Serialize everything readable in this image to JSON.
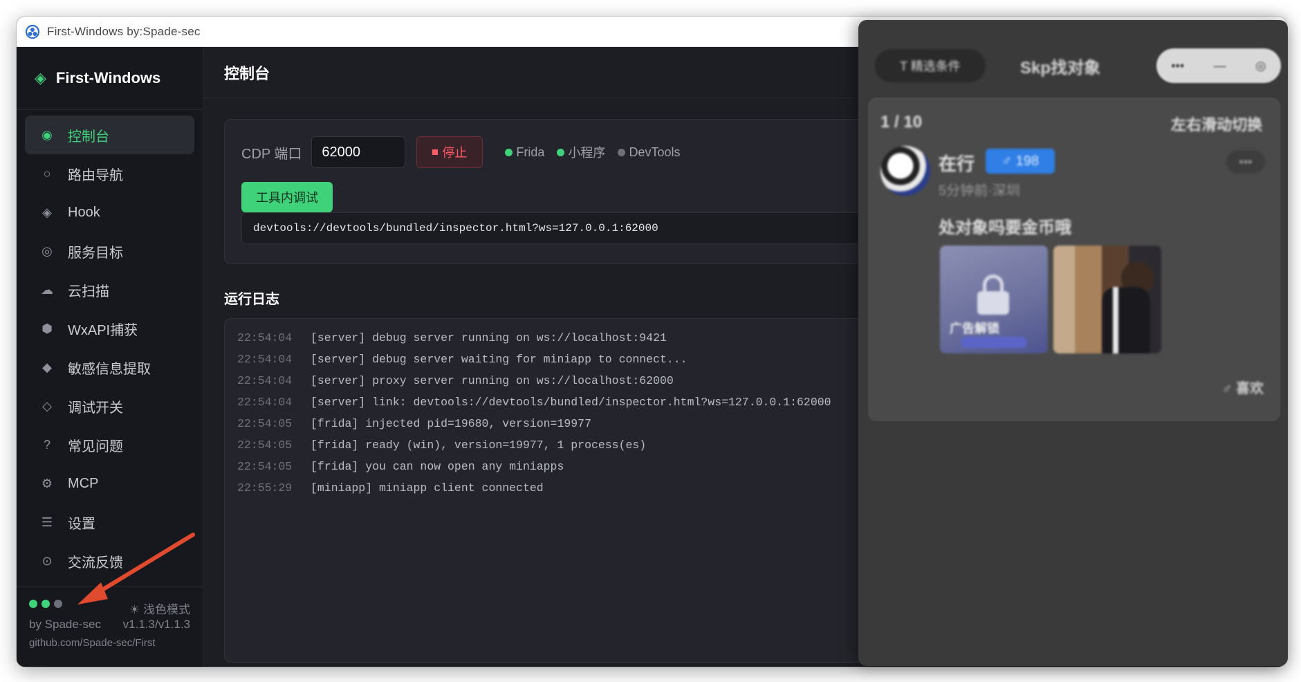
{
  "window": {
    "title": "First-Windows  by:Spade-sec"
  },
  "sidebar": {
    "brand": "First-Windows",
    "items": [
      {
        "label": "控制台",
        "icon": "target-icon"
      },
      {
        "label": "路由导航",
        "icon": "route-icon"
      },
      {
        "label": "Hook",
        "icon": "hook-icon"
      },
      {
        "label": "服务目标",
        "icon": "service-icon"
      },
      {
        "label": "云扫描",
        "icon": "cloud-icon"
      },
      {
        "label": "WxAPI捕获",
        "icon": "hexagon-icon"
      },
      {
        "label": "敏感信息提取",
        "icon": "diamond-icon"
      },
      {
        "label": "调试开关",
        "icon": "toggle-icon"
      },
      {
        "label": "常见问题",
        "icon": "question-icon"
      },
      {
        "label": "MCP",
        "icon": "gear-icon"
      },
      {
        "label": "设置",
        "icon": "menu-icon"
      },
      {
        "label": "交流反馈",
        "icon": "feedback-icon"
      }
    ],
    "footer": {
      "theme_toggle": "浅色模式",
      "author": "by Spade-sec",
      "version": "v1.1.3/v1.1.3",
      "repo": "github.com/Spade-sec/First"
    }
  },
  "main": {
    "page_title": "控制台",
    "cdp": {
      "label": "CDP 端口",
      "port_value": "62000",
      "stop_label": "停止",
      "statuses": [
        {
          "label": "Frida",
          "color": "#3fd27a"
        },
        {
          "label": "小程序",
          "color": "#3fd27a"
        },
        {
          "label": "DevTools",
          "color": "#6e717b"
        }
      ],
      "debug_button": "工具内调试",
      "devtools_url": "devtools://devtools/bundled/inspector.html?ws=127.0.0.1:62000"
    },
    "log_title": "运行日志",
    "logs": [
      {
        "time": "22:54:04",
        "msg": "[server] debug server running on ws://localhost:9421"
      },
      {
        "time": "22:54:04",
        "msg": "[server] debug server waiting for miniapp to connect..."
      },
      {
        "time": "22:54:04",
        "msg": "[server] proxy server running on ws://localhost:62000"
      },
      {
        "time": "22:54:04",
        "msg": "[server] link: devtools://devtools/bundled/inspector.html?ws=127.0.0.1:62000"
      },
      {
        "time": "22:54:05",
        "msg": "[frida] injected pid=19680, version=19977"
      },
      {
        "time": "22:54:05",
        "msg": "[frida] ready (win), version=19977, 1 process(es)"
      },
      {
        "time": "22:54:05",
        "msg": "[frida] you can now open any miniapps"
      },
      {
        "time": "22:55:29",
        "msg": "[miniapp] miniapp client connected"
      }
    ]
  },
  "overlay": {
    "pill_left": "T 精选条件",
    "title": "Skp找对象",
    "controls": [
      "•••",
      "—",
      "◎"
    ],
    "count": "1 / 10",
    "hint": "左右滑动切换",
    "user_name": "在行",
    "badge": "♂ 198",
    "subtitle": "5分钟前·深圳",
    "more": "•••",
    "post_text": "处对象吗要金币哦",
    "image_label": "广告解锁",
    "like": "♂ 喜欢"
  },
  "colors": {
    "accent": "#3fd27a",
    "danger": "#ff5a66",
    "annotation_arrow": "#e04a2f"
  }
}
